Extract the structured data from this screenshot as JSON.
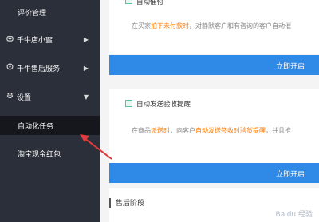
{
  "sidebar": {
    "items": [
      {
        "label": "评价管理",
        "icon": "none",
        "arrow": ""
      },
      {
        "label": "千牛店小蜜",
        "icon": "robot-icon",
        "arrow": "▶"
      },
      {
        "label": "千牛售后服务",
        "icon": "service-icon",
        "arrow": "▶"
      },
      {
        "label": "设置",
        "icon": "gear-icon",
        "arrow": "▼"
      },
      {
        "label": "自动化任务",
        "icon": "none",
        "arrow": ""
      },
      {
        "label": "淘宝现金红包",
        "icon": "none",
        "arrow": ""
      }
    ]
  },
  "main": {
    "card1": {
      "title": "自动催付",
      "desc_prefix": "在买家",
      "desc_highlight": "拍下未付款时",
      "desc_suffix": "，对静默客户和有咨询的客户自动催",
      "button": "立即开启"
    },
    "card2": {
      "title": "自动发送验收提醒",
      "desc_prefix": "在商品",
      "desc_highlight1": "派送时",
      "desc_middle": "，向客户",
      "desc_highlight2": "自动发送签收时验货提醒",
      "desc_suffix": "，并且推",
      "button": "立即开启"
    },
    "section_title": "售后阶段"
  },
  "colors": {
    "sidebar_bg": "#2b2f3a",
    "active_bg": "#15171d",
    "button_blue": "#2e8ae6",
    "highlight": "#ff7a00",
    "arrow_red": "#e23b3b"
  },
  "watermark": "Baidu 经验"
}
